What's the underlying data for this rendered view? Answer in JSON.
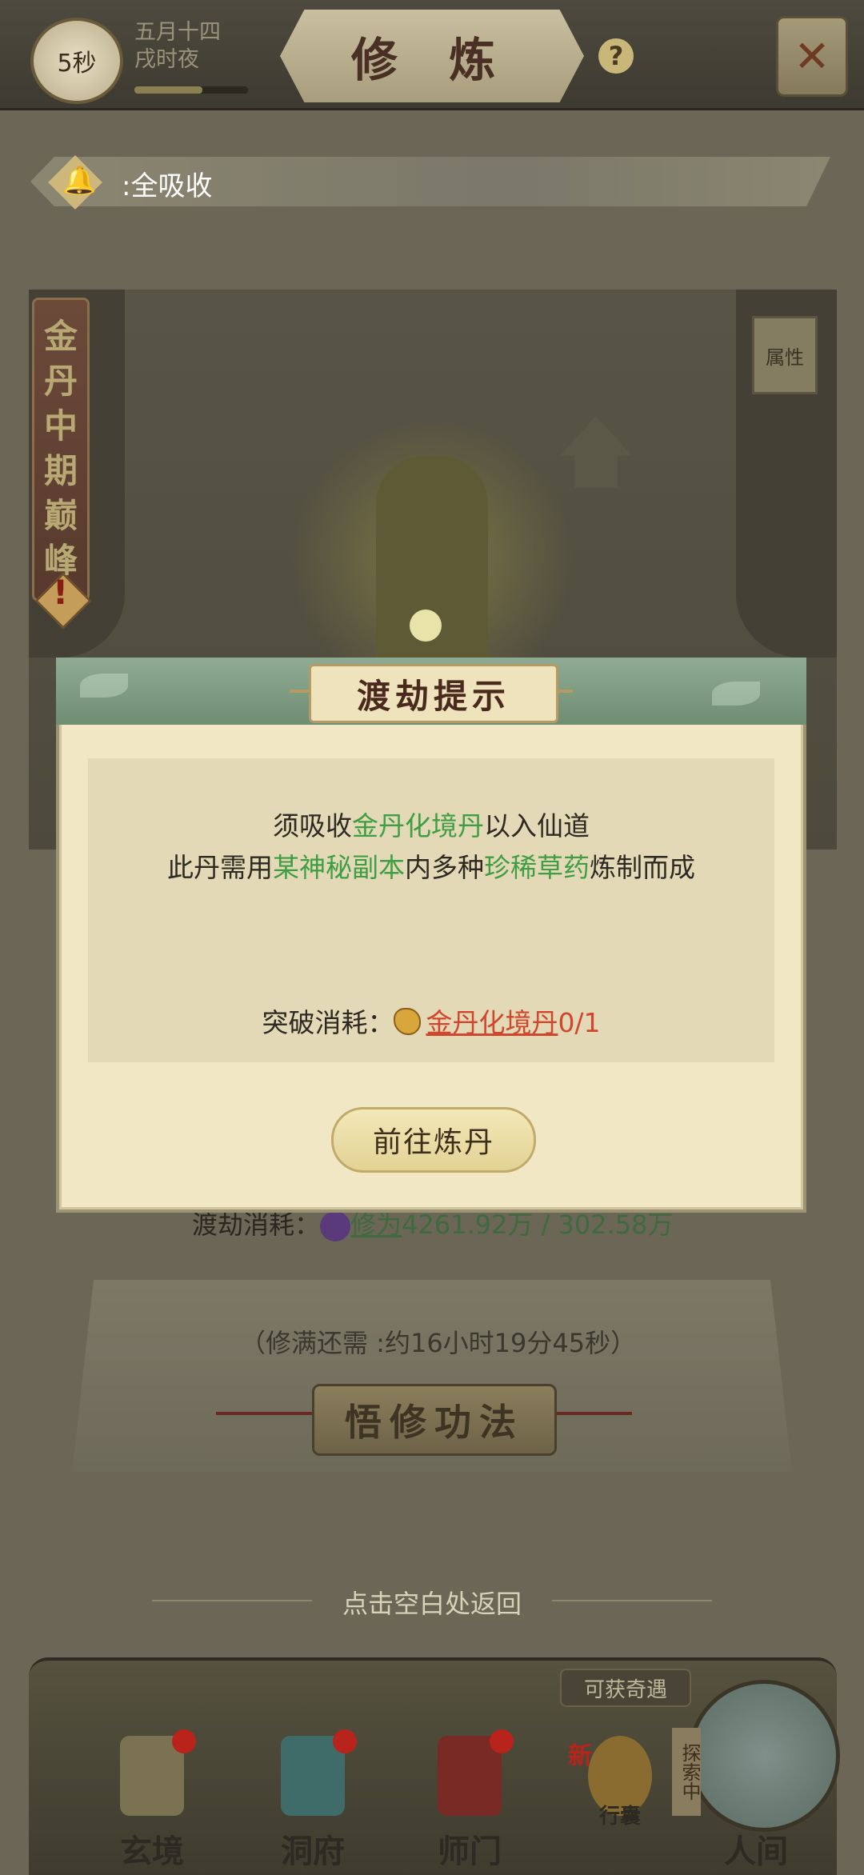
{
  "topbar": {
    "timer": "5秒",
    "date_line1": "五月十四",
    "date_line2": "戌时夜",
    "title": "修 炼",
    "help": "?",
    "close": "✕"
  },
  "notice": {
    "text": ":全吸收"
  },
  "scene": {
    "attr_label": "属性",
    "rank_chars": [
      "金",
      "丹",
      "中",
      "期",
      "巅",
      "峰"
    ],
    "rank_alert": "!"
  },
  "behind": {
    "cost_label": "渡劫消耗：",
    "cost_item": "修为",
    "cost_values": "4261.92万 / 302.58万",
    "remaining": "（修满还需 :约16小时19分45秒）",
    "wuxiu_button": "悟修功法",
    "back_hint": "点击空白处返回"
  },
  "dialog": {
    "title": "渡劫提示",
    "line1_a": "须吸收",
    "line1_hl": "金丹化境丹",
    "line1_b": "以入仙道",
    "line2_a": "此丹需用",
    "line2_hl1": "某神秘副本",
    "line2_b": "内多种",
    "line2_hl2": "珍稀草药",
    "line2_c": "炼制而成",
    "cost_label": "突破消耗：",
    "cost_item": "金丹化境丹",
    "cost_count": "0/1",
    "button": "前往炼丹"
  },
  "bottom_nav": {
    "explore_tag": "可获奇遇",
    "searching": "探索中",
    "items": [
      {
        "label": "玄境"
      },
      {
        "label": "洞府"
      },
      {
        "label": "师门"
      },
      {
        "label": "行囊",
        "badge": "新"
      },
      {
        "label": "人间"
      }
    ]
  },
  "colors": {
    "highlight_green": "#3f9e43",
    "requirement_red": "#d0472e",
    "dialog_bg": "#f1e7c4",
    "header_green": "#7f9c82"
  }
}
